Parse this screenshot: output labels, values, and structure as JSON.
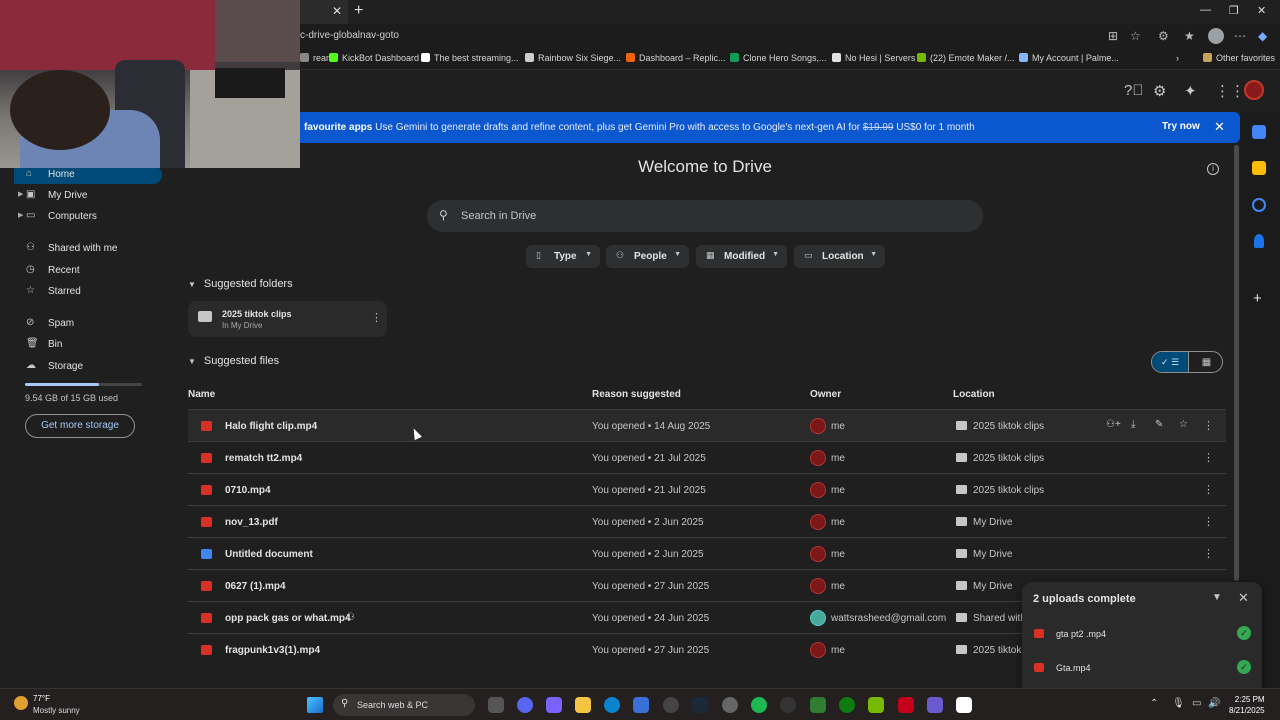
{
  "browser": {
    "url": "c-drive-globalnav-goto",
    "bookmarks": [
      {
        "label": "ream",
        "color": "#888888"
      },
      {
        "label": "KickBot Dashboard",
        "color": "#53fc18"
      },
      {
        "label": "The best streaming...",
        "color": "#ffffff"
      },
      {
        "label": "Rainbow Six Siege...",
        "color": "#cccccc"
      },
      {
        "label": "Dashboard – Replic...",
        "color": "#f26207"
      },
      {
        "label": "Clone Hero Songs,...",
        "color": "#0f9d58"
      },
      {
        "label": "No Hesi | Servers",
        "color": "#e3e3e3"
      },
      {
        "label": "(22) Emote Maker /...",
        "color": "#76b900"
      },
      {
        "label": "My Account | Palme...",
        "color": "#8ab4f8"
      }
    ],
    "other_favorites": "Other favorites"
  },
  "banner": {
    "bold": "favourite apps",
    "text": "Use Gemini to generate drafts and refine content, plus get Gemini Pro with access to Google's next-gen AI for",
    "old_price": "$19.99",
    "new_price": "US$0 for 1 month",
    "try_label": "Try now"
  },
  "nav": {
    "items": [
      {
        "label": "Home",
        "icon": "home-icon",
        "glyph": "⌂"
      },
      {
        "label": "My Drive",
        "icon": "drive-icon",
        "glyph": "▣"
      },
      {
        "label": "Computers",
        "icon": "computer-icon",
        "glyph": "▭"
      },
      {
        "label": "Shared with me",
        "icon": "people-icon",
        "glyph": "⚇"
      },
      {
        "label": "Recent",
        "icon": "clock-icon",
        "glyph": "◷"
      },
      {
        "label": "Starred",
        "icon": "star-icon",
        "glyph": "☆"
      },
      {
        "label": "Spam",
        "icon": "spam-icon",
        "glyph": "⊘"
      },
      {
        "label": "Bin",
        "icon": "bin-icon",
        "glyph": "🗑"
      },
      {
        "label": "Storage",
        "icon": "cloud-icon",
        "glyph": "☁"
      }
    ],
    "storage_used_fraction": 0.63,
    "storage_text": "9.54 GB of 15 GB used",
    "get_storage": "Get more storage"
  },
  "main": {
    "title": "Welcome to Drive",
    "search_placeholder": "Search in Drive",
    "filters": [
      "Type",
      "People",
      "Modified",
      "Location"
    ],
    "suggested_folders_label": "Suggested folders",
    "folder": {
      "name": "2025 tiktok clips",
      "sub": "In My Drive"
    },
    "suggested_files_label": "Suggested files",
    "columns": {
      "name": "Name",
      "reason": "Reason suggested",
      "owner": "Owner",
      "location": "Location"
    },
    "files": [
      {
        "name": "Halo flight clip.mp4",
        "type": "video",
        "reason": "You opened • 14 Aug 2025",
        "owner": "me",
        "location": "2025 tiktok clips",
        "loc_type": "folder",
        "shared": false
      },
      {
        "name": "rematch tt2.mp4",
        "type": "video",
        "reason": "You opened • 21 Jul 2025",
        "owner": "me",
        "location": "2025 tiktok clips",
        "loc_type": "folder",
        "shared": false
      },
      {
        "name": "0710.mp4",
        "type": "video",
        "reason": "You opened • 21 Jul 2025",
        "owner": "me",
        "location": "2025 tiktok clips",
        "loc_type": "folder",
        "shared": false
      },
      {
        "name": "nov_13.pdf",
        "type": "pdf",
        "reason": "You opened • 2 Jun 2025",
        "owner": "me",
        "location": "My Drive",
        "loc_type": "drive",
        "shared": false
      },
      {
        "name": "Untitled document",
        "type": "doc",
        "reason": "You opened • 2 Jun 2025",
        "owner": "me",
        "location": "My Drive",
        "loc_type": "drive",
        "shared": false
      },
      {
        "name": "0627 (1).mp4",
        "type": "video",
        "reason": "You opened • 27 Jun 2025",
        "owner": "me",
        "location": "My Drive",
        "loc_type": "drive",
        "shared": false
      },
      {
        "name": "opp pack gas or what.mp4",
        "type": "video",
        "reason": "You opened • 24 Jun 2025",
        "owner": "wattsrasheed@gmail.com",
        "location": "Shared with",
        "loc_type": "shared",
        "shared": true
      },
      {
        "name": "fragpunk1v3(1).mp4",
        "type": "video",
        "reason": "You opened • 27 Jun 2025",
        "owner": "me",
        "location": "2025 tiktok",
        "loc_type": "folder",
        "shared": false
      }
    ]
  },
  "uploads": {
    "title": "2 uploads complete",
    "items": [
      "gta pt2 .mp4",
      "Gta.mp4"
    ]
  },
  "taskbar": {
    "temp": "77°F",
    "condition": "Mostly sunny",
    "search": "Search web & PC",
    "time": "2:25 PM",
    "date": "8/21/2025"
  },
  "colors": {
    "accent": "#0b57d0",
    "active_nav": "#004a77",
    "video": "#d93025",
    "doc": "#4285f4"
  }
}
